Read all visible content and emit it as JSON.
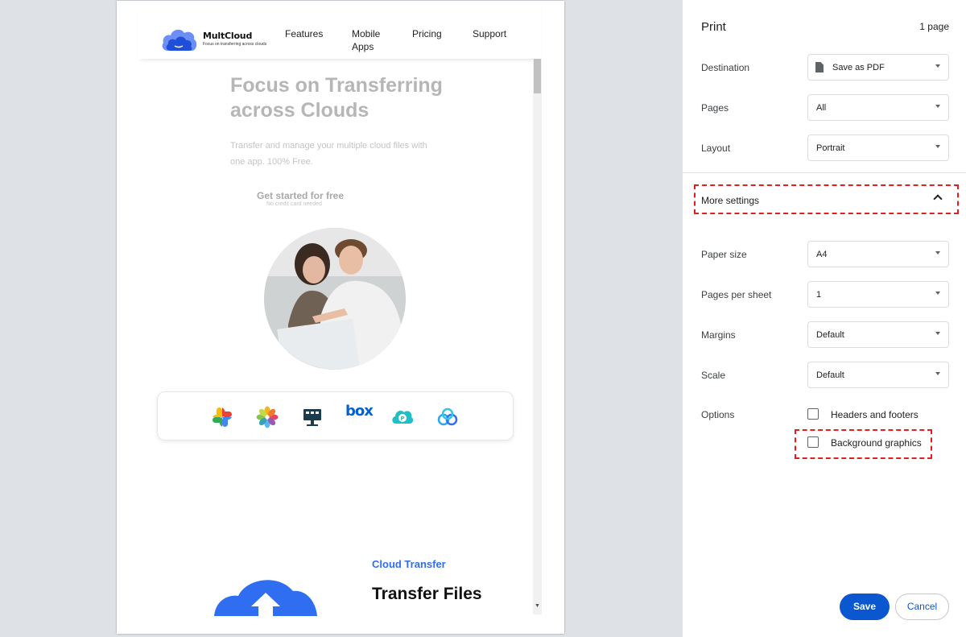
{
  "website": {
    "logo": {
      "title": "MultCloud",
      "tagline": "Focus on transferring across clouds"
    },
    "nav": [
      "Features",
      "Mobile Apps",
      "Pricing",
      "Support"
    ],
    "hero": {
      "title": "Focus on Transferring across Clouds",
      "description": "Transfer and manage your multiple cloud files with one app. 100% Free.",
      "cta_label": "Get started for free",
      "cta_sub": "No credit card needed"
    },
    "cloud_icons": [
      "google-photos-icon",
      "icloud-photos-icon",
      "nas-icon",
      "box-icon",
      "pcloud-icon",
      "baidu-cloud-icon"
    ],
    "box_text": "box",
    "section": {
      "label": "Cloud Transfer",
      "title": "Transfer Files"
    }
  },
  "print": {
    "title": "Print",
    "page_count": "1 page",
    "destination": {
      "label": "Destination",
      "value": "Save as PDF"
    },
    "pages": {
      "label": "Pages",
      "value": "All"
    },
    "layout": {
      "label": "Layout",
      "value": "Portrait"
    },
    "more_settings": "More settings",
    "paper_size": {
      "label": "Paper size",
      "value": "A4"
    },
    "pages_per_sheet": {
      "label": "Pages per sheet",
      "value": "1"
    },
    "margins": {
      "label": "Margins",
      "value": "Default"
    },
    "scale": {
      "label": "Scale",
      "value": "Default"
    },
    "options": {
      "label": "Options",
      "headers_footers": {
        "label": "Headers and footers",
        "checked": false
      },
      "background_graphics": {
        "label": "Background graphics",
        "checked": false
      }
    },
    "save": "Save",
    "cancel": "Cancel"
  },
  "colors": {
    "accent": "#0b57d0",
    "highlight": "#e02020",
    "link": "#2f6ef0"
  }
}
